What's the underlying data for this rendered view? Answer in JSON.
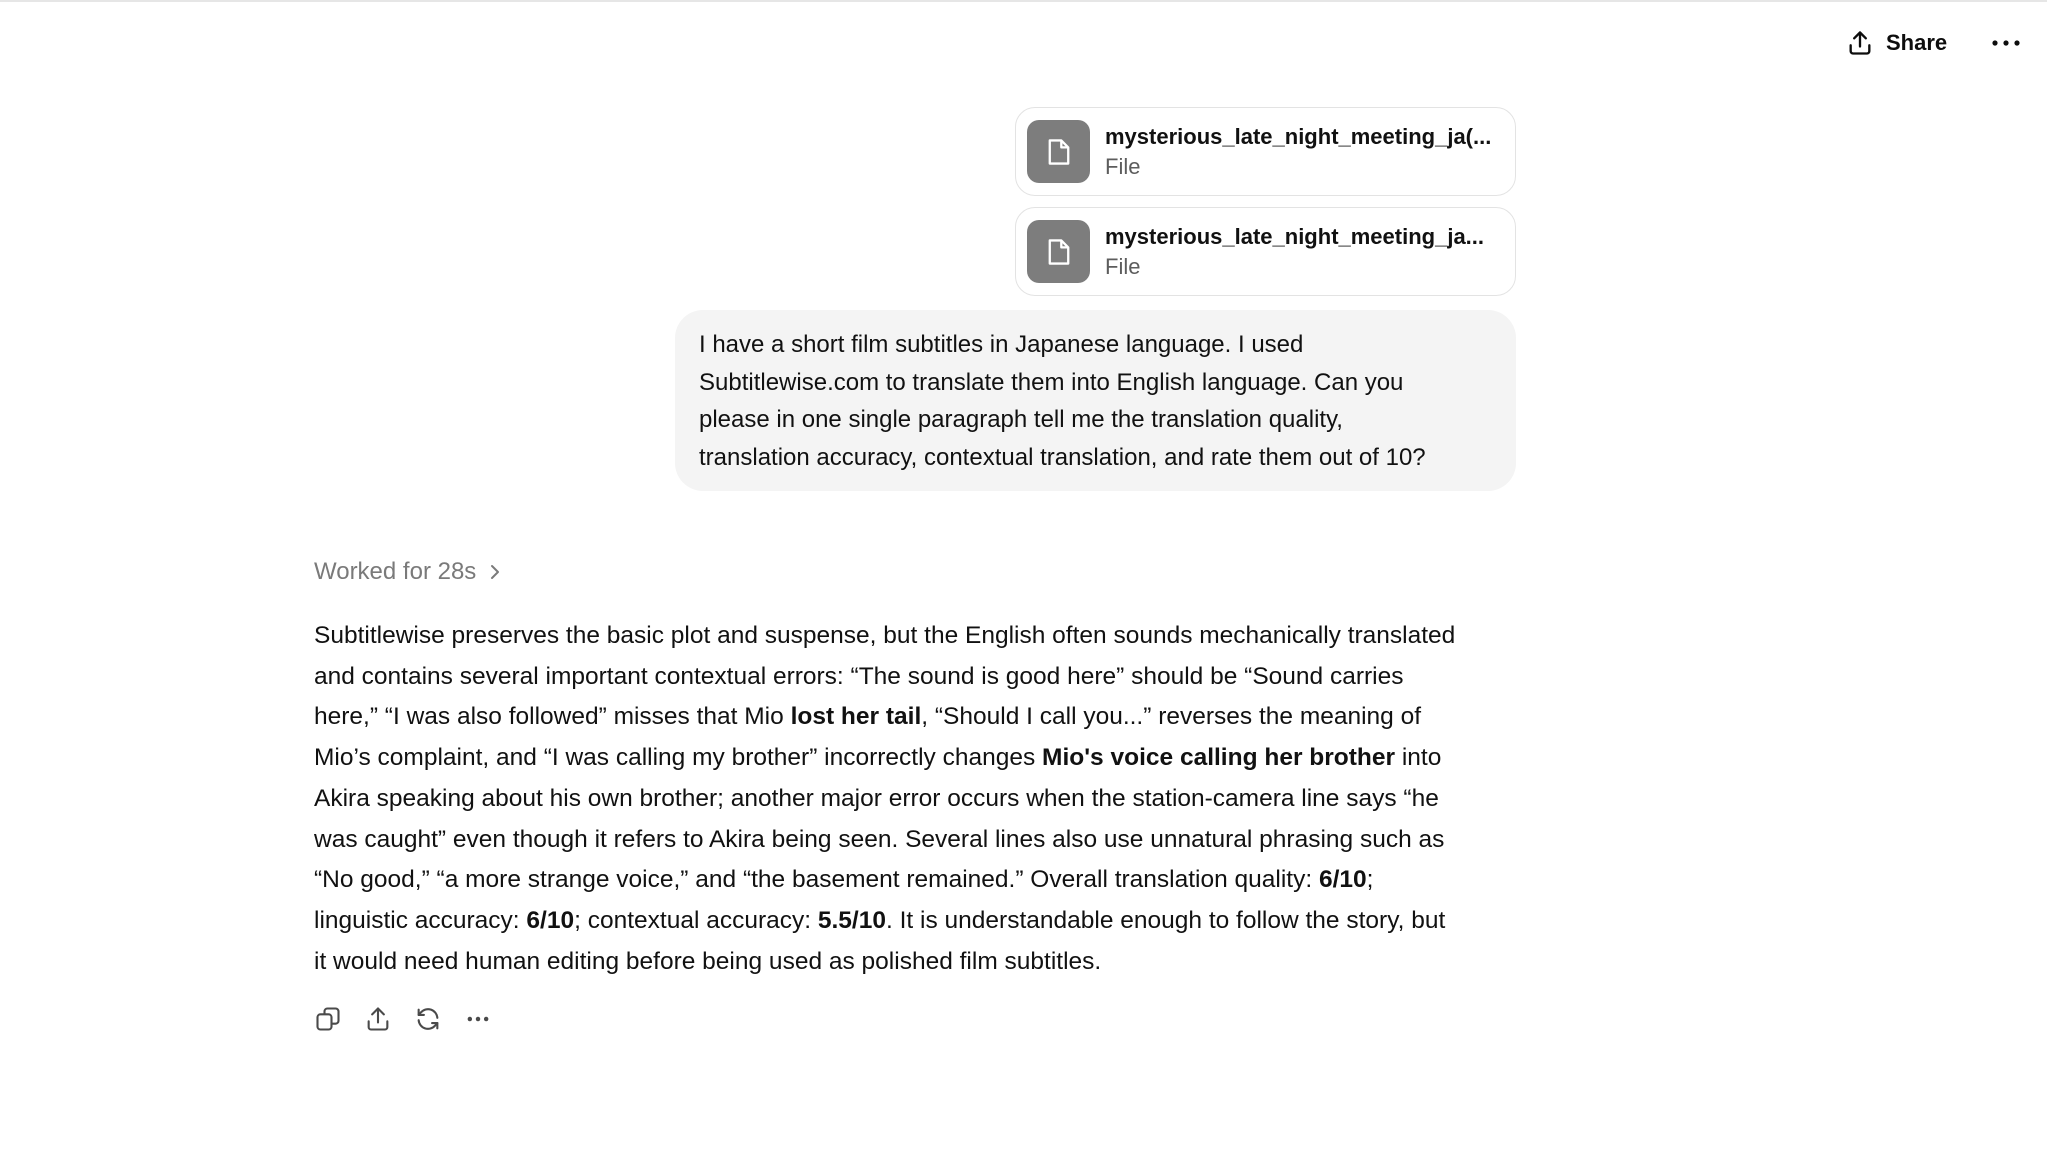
{
  "header": {
    "share_label": "Share",
    "share_icon": "share-icon",
    "more_icon": "more-horizontal-icon"
  },
  "attachments": [
    {
      "name": "mysterious_late_night_meeting_ja(...",
      "type": "File",
      "icon": "file-icon"
    },
    {
      "name": "mysterious_late_night_meeting_ja...",
      "type": "File",
      "icon": "file-icon"
    }
  ],
  "user_message": {
    "lines": [
      "I have a short film subtitles in Japanese language. I used",
      "Subtitlewise.com to translate them into English language. Can you",
      "please in one single paragraph tell me the translation quality,",
      "translation accuracy, contextual translation, and rate them out of 10?"
    ]
  },
  "worked": {
    "label": "Worked for 28s",
    "icon": "chevron-right-icon"
  },
  "answer": {
    "lines": [
      [
        {
          "t": "Subtitlewise preserves the basic plot and suspense, but the English often sounds mechanically translated"
        }
      ],
      [
        {
          "t": "and contains several important contextual errors: “The sound is good here” should be “Sound carries"
        }
      ],
      [
        {
          "t": "here,” “I was also followed” misses that Mio "
        },
        {
          "t": "lost her tail",
          "b": true
        },
        {
          "t": ", “Should I call you...” reverses the meaning of"
        }
      ],
      [
        {
          "t": "Mio’s complaint, and “I was calling my brother” incorrectly changes "
        },
        {
          "t": "Mio's voice calling her brother",
          "b": true
        },
        {
          "t": " into"
        }
      ],
      [
        {
          "t": "Akira speaking about his own brother; another major error occurs when the station-camera line says “he"
        }
      ],
      [
        {
          "t": "was caught” even though it refers to Akira being seen. Several lines also use unnatural phrasing such as"
        }
      ],
      [
        {
          "t": "“No good,” “a more strange voice,” and “the basement remained.” Overall translation quality: "
        },
        {
          "t": "6/10",
          "b": true
        },
        {
          "t": ";"
        }
      ],
      [
        {
          "t": "linguistic accuracy: "
        },
        {
          "t": "6/10",
          "b": true
        },
        {
          "t": "; contextual accuracy: "
        },
        {
          "t": "5.5/10",
          "b": true
        },
        {
          "t": ". It is understandable enough to follow the story, but"
        }
      ],
      [
        {
          "t": "it would need human editing before being used as polished film subtitles."
        }
      ]
    ]
  },
  "actions": [
    {
      "name": "copy-button",
      "icon": "copy-icon"
    },
    {
      "name": "share-response-button",
      "icon": "share-icon"
    },
    {
      "name": "regenerate-button",
      "icon": "refresh-icon"
    },
    {
      "name": "more-actions-button",
      "icon": "more-horizontal-icon"
    }
  ]
}
